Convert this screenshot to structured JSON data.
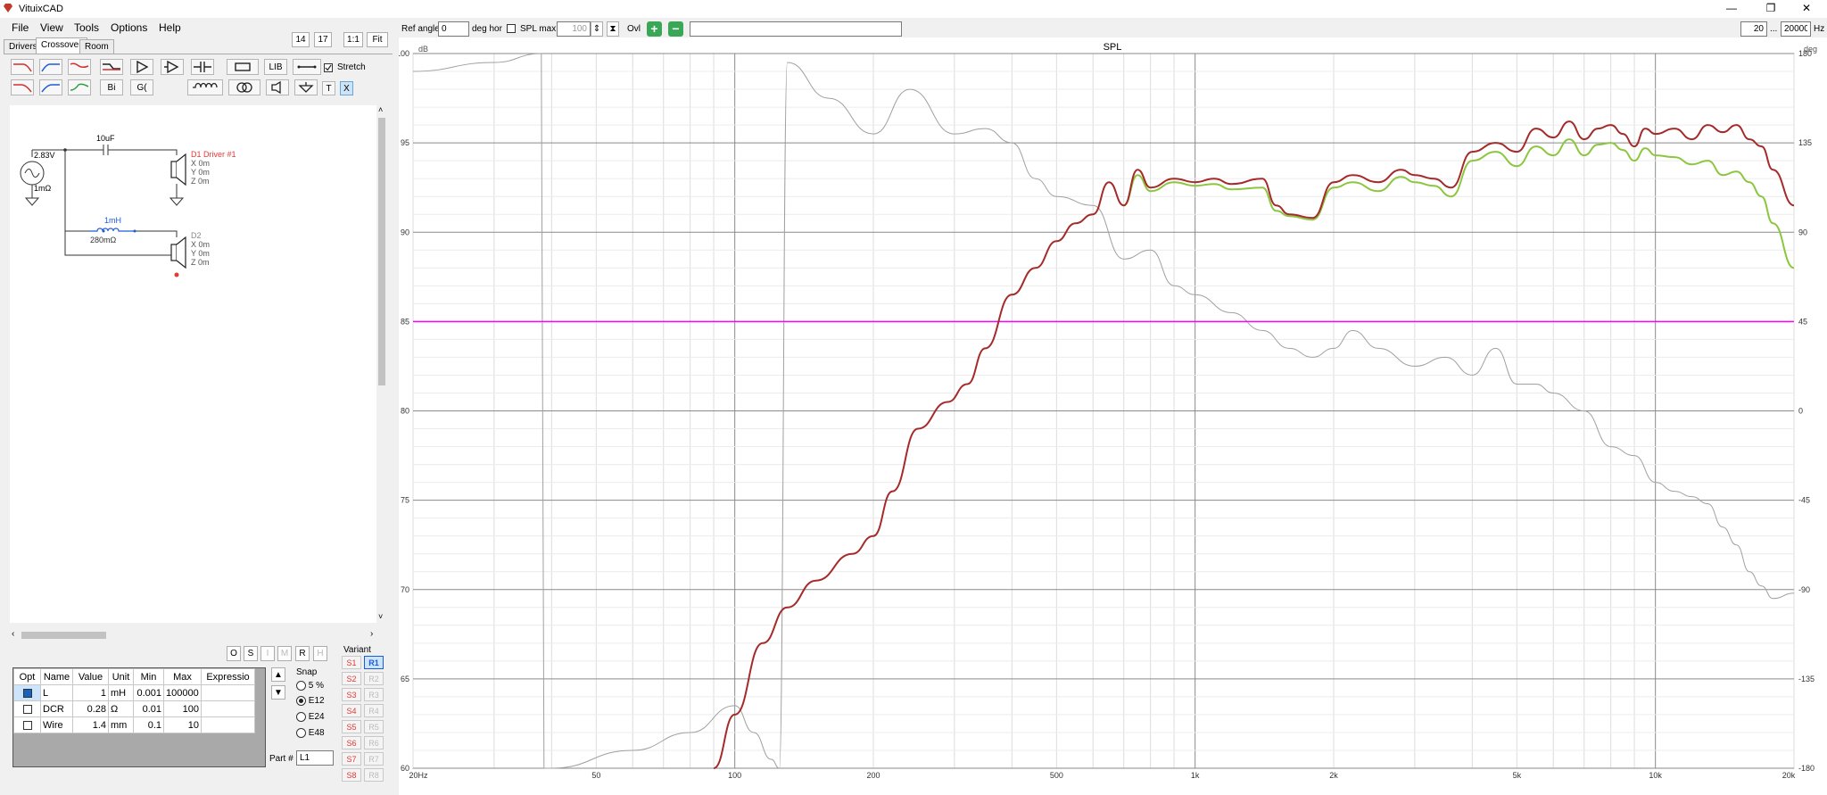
{
  "app": {
    "title": "VituixCAD"
  },
  "window_controls": {
    "minimize": "—",
    "restore": "❐",
    "close": "✕"
  },
  "menu": [
    "File",
    "View",
    "Tools",
    "Options",
    "Help"
  ],
  "tabs": [
    "Drivers",
    "Crossover",
    "Room"
  ],
  "zoom_buttons": [
    "14",
    "17",
    "1:1",
    "Fit"
  ],
  "toolbar": {
    "bi_label": "Bi",
    "g_label": "G(",
    "lib_label": "LIB",
    "t_label": "T",
    "x_label": "X",
    "stretch_label": "Stretch",
    "stretch_checked": true
  },
  "schematic": {
    "source_voltage": "2.83V",
    "source_resistance": "1mΩ",
    "capacitor": "10uF",
    "inductor": "1mH",
    "inductor_resistance": "280mΩ",
    "driver1": {
      "name": "D1 Driver #1",
      "x": "X 0m",
      "y": "Y 0m",
      "z": "Z 0m"
    },
    "driver2": {
      "name": "D2",
      "x": "X 0m",
      "y": "Y 0m",
      "z": "Z 0m"
    }
  },
  "grid_buttons": [
    "O",
    "S",
    "I",
    "M",
    "R",
    "H"
  ],
  "part_table": {
    "headers": [
      "Opt",
      "Name",
      "Value",
      "Unit",
      "Min",
      "Max",
      "Expressio"
    ],
    "rows": [
      {
        "name": "L",
        "value": "1",
        "unit": "mH",
        "min": "0.001",
        "max": "100000",
        "expr": ""
      },
      {
        "name": "DCR",
        "value": "0.28",
        "unit": "Ω",
        "min": "0.01",
        "max": "100",
        "expr": ""
      },
      {
        "name": "Wire",
        "value": "1.4",
        "unit": "mm",
        "min": "0.1",
        "max": "10",
        "expr": ""
      }
    ]
  },
  "snap": {
    "label": "Snap",
    "options": [
      "5 %",
      "E12",
      "E24",
      "E48"
    ],
    "selected": "E12"
  },
  "part_number": {
    "label": "Part #",
    "value": "L1"
  },
  "variant": {
    "label": "Variant",
    "s": [
      "S1",
      "S2",
      "S3",
      "S4",
      "S5",
      "S6",
      "S7",
      "S8"
    ],
    "r": [
      "R1",
      "R2",
      "R3",
      "R4",
      "R5",
      "R6",
      "R7",
      "R8"
    ],
    "selected": "R1"
  },
  "plot_toolbar": {
    "ref_angle_label": "Ref angle",
    "ref_angle_value": "0",
    "deg_hor_label": "deg hor",
    "spl_max_label": "SPL max",
    "spl_max_value": "100",
    "ovl_label": "Ovl",
    "freq_min": "20",
    "freq_sep": "...",
    "freq_max": "20000",
    "hz_label": "Hz"
  },
  "colors": {
    "red": "#a52a2a",
    "green": "#8cc63f",
    "gray": "#a0a0a0",
    "magenta": "#ff00ff"
  },
  "chart_data": {
    "type": "line",
    "title": "SPL",
    "ylabel_left": "dB",
    "ylabel_right": "deg",
    "x_scale": "log",
    "xlim": [
      20,
      20000
    ],
    "ylim": [
      60,
      100
    ],
    "y2lim": [
      -180,
      180
    ],
    "x_ticks": [
      "20Hz",
      "50",
      "100",
      "200",
      "500",
      "1k",
      "2k",
      "5k",
      "10k",
      "20k"
    ],
    "y_ticks": [
      "60",
      "65",
      "70",
      "75",
      "80",
      "85",
      "90",
      "95",
      "100"
    ],
    "y2_ticks": [
      "-180",
      "-135",
      "-90",
      "-45",
      "0",
      "45",
      "90",
      "135",
      "180"
    ],
    "grid": true,
    "series": [
      {
        "color": "#a52a2a",
        "x": [
          90,
          100,
          115,
          130,
          150,
          180,
          200,
          220,
          250,
          290,
          320,
          350,
          400,
          450,
          500,
          550,
          600,
          650,
          700,
          750,
          800,
          900,
          1000,
          1100,
          1200,
          1400,
          1500,
          1600,
          1800,
          2000,
          2200,
          2500,
          2800,
          3000,
          3300,
          3600,
          4000,
          4500,
          5000,
          5500,
          6000,
          6500,
          7000,
          7500,
          8000,
          8500,
          9000,
          9500,
          10000,
          11000,
          12000,
          13000,
          14000,
          15000,
          16000,
          17000,
          18000,
          20000
        ],
        "y": [
          60,
          63,
          67,
          69,
          70.5,
          72,
          73,
          75.5,
          79,
          80.5,
          81.5,
          83.5,
          86.5,
          88,
          89.5,
          90.5,
          91,
          92.8,
          91.5,
          93.5,
          92.5,
          93,
          92.8,
          93,
          92.7,
          93,
          91.5,
          91,
          90.8,
          92.8,
          93.2,
          92.8,
          93.5,
          93.2,
          93,
          92.5,
          94.5,
          95,
          94.5,
          95.8,
          95.3,
          96.2,
          95.2,
          95.8,
          96,
          95.5,
          94.8,
          95.8,
          95.5,
          95.8,
          95.2,
          96,
          95.6,
          96,
          95.2,
          94.8,
          93.5,
          91.5
        ]
      },
      {
        "color": "#8cc63f",
        "x": [
          700,
          750,
          800,
          900,
          1000,
          1100,
          1200,
          1400,
          1500,
          1600,
          1800,
          2000,
          2200,
          2500,
          2800,
          3000,
          3300,
          3600,
          4000,
          4500,
          5000,
          5500,
          6000,
          6500,
          7000,
          7500,
          8000,
          8500,
          9000,
          9500,
          10000,
          11000,
          12000,
          13000,
          14000,
          15000,
          16000,
          17000,
          18000,
          20000
        ],
        "y": [
          91.5,
          93.2,
          92.3,
          92.8,
          92.6,
          92.7,
          92.4,
          92.5,
          91.2,
          90.9,
          90.7,
          92.5,
          92.8,
          92.3,
          93.1,
          92.8,
          92.6,
          92,
          94,
          94.5,
          93.7,
          94.8,
          94.3,
          95.2,
          94.3,
          94.9,
          95,
          94.6,
          94,
          94.7,
          94.3,
          94.2,
          93.8,
          94,
          93.2,
          93.4,
          92.8,
          92,
          90.5,
          88
        ]
      },
      {
        "color": "#a0a0a0",
        "x": [
          20,
          30,
          38,
          38.5,
          40,
          60,
          80,
          100,
          110,
          120,
          125,
          130,
          160,
          200,
          240,
          300,
          350,
          400,
          450,
          500,
          600,
          700,
          800,
          900,
          1000,
          1200,
          1400,
          1600,
          1800,
          2000,
          2200,
          2500,
          3000,
          3500,
          4000,
          4500,
          5000,
          5500,
          6000,
          7000,
          8000,
          9000,
          10000,
          11000,
          12000,
          13000,
          14000,
          15000,
          16000,
          17000,
          18000,
          20000
        ],
        "y": [
          99,
          99.5,
          100,
          60,
          60,
          61,
          62,
          63.5,
          62,
          60.5,
          60,
          99.5,
          97.5,
          95.5,
          98,
          95.5,
          95.8,
          95,
          93,
          92,
          91.5,
          88.5,
          89,
          87,
          86.5,
          85.5,
          84.5,
          83.5,
          83,
          83.5,
          84.5,
          83.5,
          82.5,
          83,
          82,
          83.5,
          81.5,
          81.5,
          81,
          80,
          78,
          77.5,
          76,
          75.5,
          75.2,
          74.8,
          73.5,
          72.5,
          71,
          70.2,
          69.5,
          69.8
        ]
      },
      {
        "color": "#ff00ff",
        "x": [
          20,
          20000
        ],
        "y": [
          85,
          85
        ]
      }
    ]
  }
}
